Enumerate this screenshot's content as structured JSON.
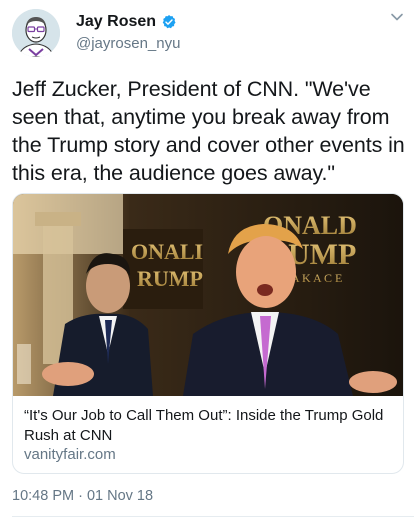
{
  "author": {
    "display_name": "Jay Rosen",
    "handle": "@jayrosen_nyu",
    "verified": true,
    "avatar_icon": "cartoon-portrait-avatar",
    "verified_icon": "verified-badge-icon"
  },
  "tweet": {
    "text": "Jeff Zucker, President of CNN. \"We've seen that, anytime you break away from the Trump story and cover other events in this era, the audience goes away.\"",
    "timestamp": "10:48 PM · 01 Nov 18"
  },
  "link_card": {
    "title": "“It's Our Job to Call Them Out”: Inside the Trump Gold Rush at CNN",
    "domain": "vanityfair.com",
    "image_sign_text_left": "ONALI\nRUMP",
    "image_sign_text_right": "ONALD\nUMP\nA K A  C E"
  },
  "colors": {
    "text_primary": "#14171a",
    "text_secondary": "#657786",
    "verified_blue": "#1da1f2",
    "border": "#e1e8ed"
  }
}
